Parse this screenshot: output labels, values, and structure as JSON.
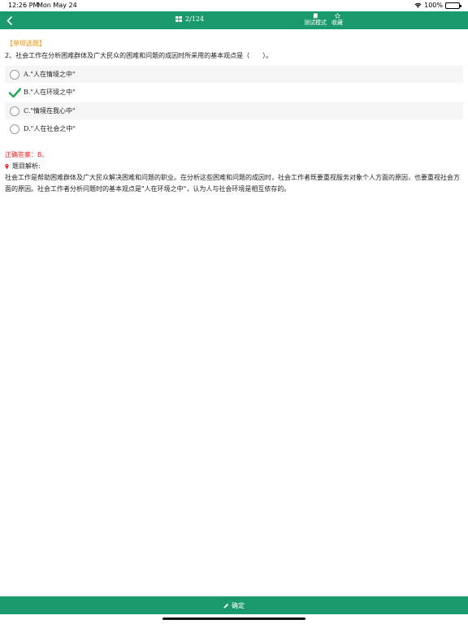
{
  "status_bar": {
    "time": "12:26 PM",
    "date": "Mon May 24",
    "battery": "100%",
    "battery_level": 1.0
  },
  "nav": {
    "progress": "2/124",
    "test_mode_label": "测试模式",
    "favorite_label": "收藏"
  },
  "question": {
    "type": "【单项选题】",
    "text": "2、社会工作在分析困难群体及广大民众的困难和问题的成因时所采用的基本观点是（　　）。",
    "options": [
      {
        "label": "A.\"人在情境之中\"",
        "selected": false
      },
      {
        "label": "B.\"人在环境之中\"",
        "selected": true
      },
      {
        "label": "C.\"情境在我心中\"",
        "selected": false
      },
      {
        "label": "D.\"人在社会之中\"",
        "selected": false
      }
    ]
  },
  "answer": {
    "text": "正确答案：B、"
  },
  "analysis": {
    "title": "题目解析:",
    "body": "社会工作是帮助困难群体及广大民众解决困难和问题的职业。在分析这些困难和问题的成因时，社会工作者既要重视服务对象个人方面的原因，也要重视社会方面的原因。社会工作者分析问题时的基本观点是\"人在环境之中\"，认为人与社会环境是相互依存的。"
  },
  "bottom": {
    "confirm_label": "确定"
  },
  "colors": {
    "primary": "#1a9a6c",
    "question_type": "#f08c00",
    "answer": "#e8231f",
    "check": "#2aa85a"
  }
}
